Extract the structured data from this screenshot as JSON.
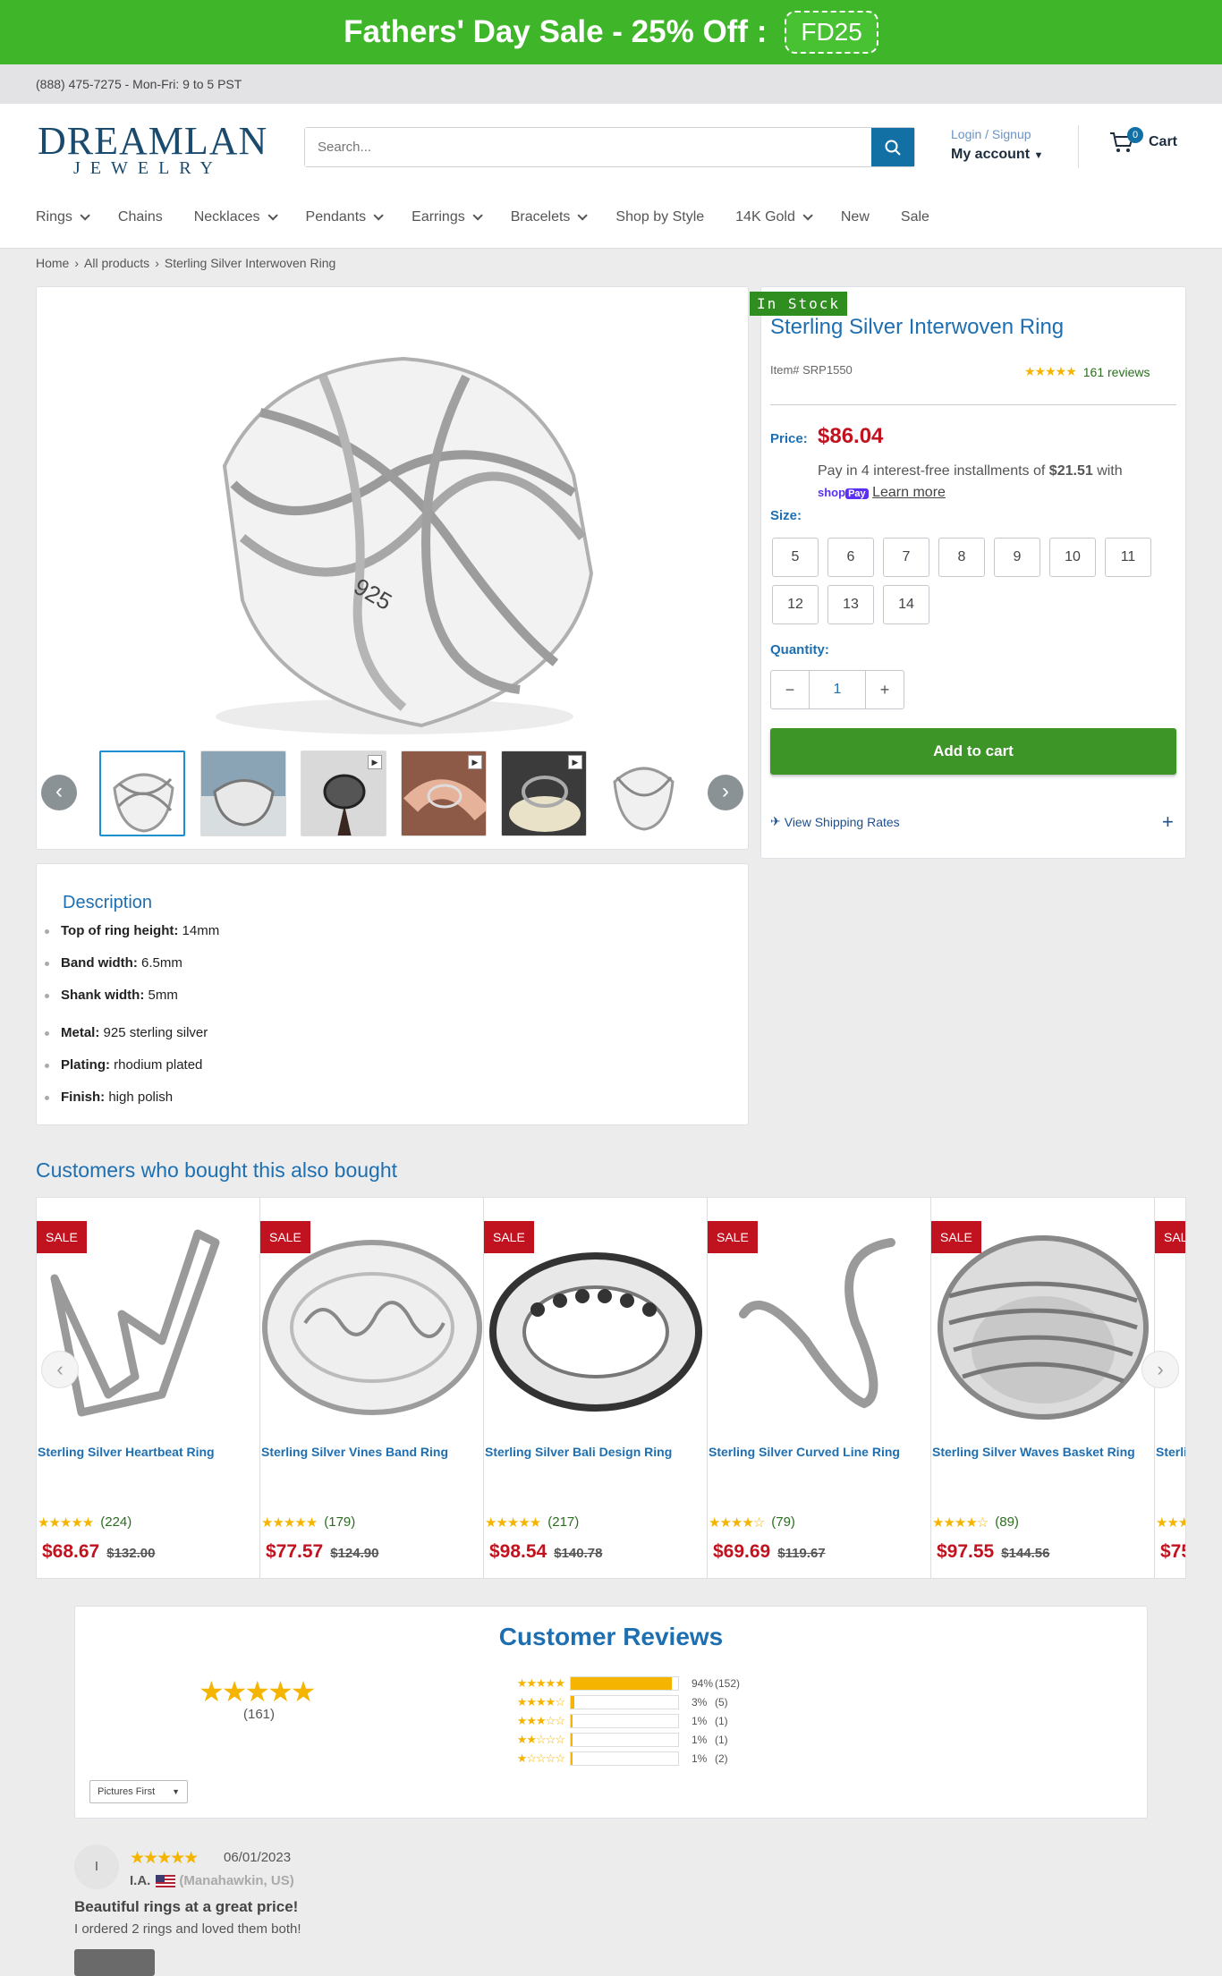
{
  "promo": {
    "text": "Fathers' Day Sale - 25% Off :",
    "code": "FD25"
  },
  "infobar": {
    "phone": "(888) 475-7275 - Mon-Fri: 9 to 5 PST"
  },
  "header": {
    "logo_main": "DREAMLAND",
    "logo_sub": "JEWELRY",
    "search_placeholder": "Search...",
    "login": "Login / Signup",
    "account": "My account",
    "cart_count": "0",
    "cart_label": "Cart"
  },
  "nav": [
    "Rings",
    "Chains",
    "Necklaces",
    "Pendants",
    "Earrings",
    "Bracelets",
    "Shop by Style",
    "14K Gold",
    "New",
    "Sale"
  ],
  "breadcrumb": [
    "Home",
    "All products",
    "Sterling Silver Interwoven Ring"
  ],
  "product": {
    "stock": "In Stock",
    "title": "Sterling Silver Interwoven Ring",
    "item": "Item# SRP1550",
    "reviews": "161 reviews",
    "price_label": "Price:",
    "price": "$86.04",
    "install_pre": "Pay in 4 interest-free installments of",
    "install_amount": "$21.51",
    "install_post": "with",
    "shoppay_shop": "shop",
    "shoppay_pay": "Pay",
    "learn_more": "Learn more",
    "size_label": "Size:",
    "sizes": [
      "5",
      "6",
      "7",
      "8",
      "9",
      "10",
      "11",
      "12",
      "13",
      "14"
    ],
    "qty_label": "Quantity:",
    "qty": "1",
    "add_to_cart": "Add to cart",
    "shipping": "View Shipping Rates",
    "accent": "#1e6fb1",
    "price_color": "#c1121f",
    "cta_color": "#3d9427"
  },
  "description": {
    "title": "Description",
    "items": [
      {
        "k": "Top of ring height:",
        "v": "14mm"
      },
      {
        "k": "Band width:",
        "v": "6.5mm"
      },
      {
        "k": "Shank width:",
        "v": "5mm"
      },
      {
        "k": "Metal:",
        "v": "925 sterling silver"
      },
      {
        "k": "Plating:",
        "v": "rhodium plated"
      },
      {
        "k": "Finish:",
        "v": "high polish"
      }
    ]
  },
  "also_bought": {
    "title": "Customers who bought this also bought",
    "sale_tag": "SALE",
    "products": [
      {
        "name": "Sterling Silver Heartbeat Ring",
        "count": "(224)",
        "price": "$68.67",
        "old": "$132.00"
      },
      {
        "name": "Sterling Silver Vines Band Ring",
        "count": "(179)",
        "price": "$77.57",
        "old": "$124.90"
      },
      {
        "name": "Sterling Silver Bali Design Ring",
        "count": "(217)",
        "price": "$98.54",
        "old": "$140.78"
      },
      {
        "name": "Sterling Silver Curved Line Ring",
        "count": "(79)",
        "price": "$69.69",
        "old": "$119.67"
      },
      {
        "name": "Sterling Silver Waves Basket Ring",
        "count": "(89)",
        "price": "$97.55",
        "old": "$144.56"
      },
      {
        "name": "Sterli",
        "count": "",
        "price": "$75",
        "old": ""
      }
    ]
  },
  "reviews": {
    "title": "Customer Reviews",
    "count": "(161)",
    "hist": [
      {
        "pct": "94%",
        "n": "(152)",
        "stars": "★★★★★",
        "fill": 0.94
      },
      {
        "pct": "3%",
        "n": "(5)",
        "stars": "★★★★☆",
        "fill": 0.03
      },
      {
        "pct": "1%",
        "n": "(1)",
        "stars": "★★★☆☆",
        "fill": 0.01
      },
      {
        "pct": "1%",
        "n": "(1)",
        "stars": "★★☆☆☆",
        "fill": 0.01
      },
      {
        "pct": "1%",
        "n": "(2)",
        "stars": "★☆☆☆☆",
        "fill": 0.01
      }
    ],
    "sort": "Pictures First",
    "first": {
      "initial": "I",
      "date": "06/01/2023",
      "name": "I.A.",
      "location": "(Manahawkin, US)",
      "title": "Beautiful rings at a great price!",
      "body": "I ordered 2 rings and loved them both!"
    }
  }
}
